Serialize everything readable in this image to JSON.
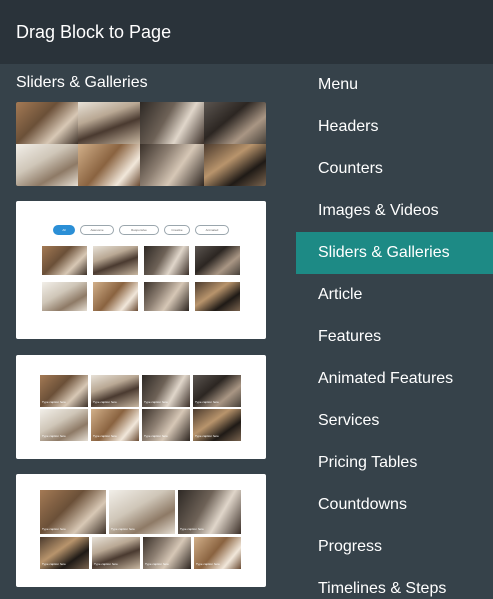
{
  "header": {
    "title": "Drag Block to Page"
  },
  "section": {
    "title": "Sliders & Galleries"
  },
  "menu": {
    "items": [
      "Menu",
      "Headers",
      "Counters",
      "Images & Videos",
      "Sliders & Galleries",
      "Article",
      "Features",
      "Animated Features",
      "Services",
      "Pricing Tables",
      "Countdowns",
      "Progress",
      "Timelines & Steps"
    ],
    "active_index": 4
  },
  "thumbnails": {
    "gallery2": {
      "filters": [
        "All",
        "Awesome",
        "Responsive",
        "Creative",
        "Animated"
      ]
    },
    "gallery3": {
      "caption": "Type caption here"
    },
    "gallery4": {
      "caption": "Type caption here"
    }
  },
  "colors": {
    "header_bg": "#2a333a",
    "panel_bg": "#36424a",
    "active_bg": "#1d8a85",
    "filter_active": "#2b8fd6"
  }
}
